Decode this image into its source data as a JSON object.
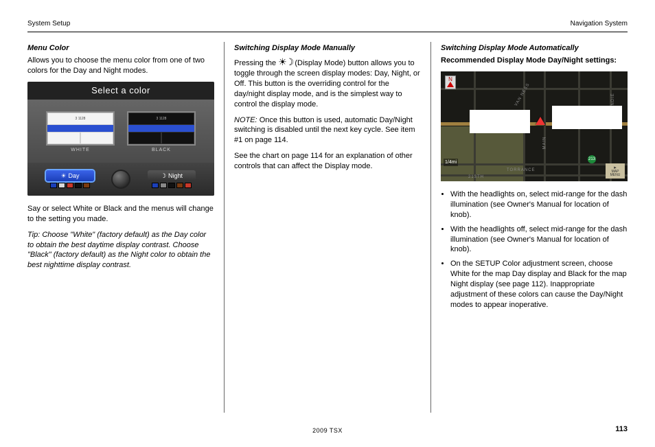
{
  "header": {
    "left": "System Setup",
    "right": "Navigation System"
  },
  "col1": {
    "heading": "Menu Color",
    "body": "Allows you to choose the menu color from one of two colors for the Day and Night modes.",
    "figA": {
      "title": "Select a color",
      "previewWhite": "WHITE",
      "previewBlack": "BLACK",
      "btnDay": "Day",
      "btnNight": "Night",
      "sampleText": "3   1128"
    },
    "p2": "Say or select White or Black and the menus will change to the setting you made.",
    "tipLabel": "Tip:",
    "tip": "Choose \"White\" (factory default) as the Day color to obtain the best daytime display contrast. Choose \"Black\" (factory default) as the Night color to obtain the best nighttime display contrast."
  },
  "col2": {
    "heading": "Switching Display Mode Manually",
    "iconLabel": "☀ ☽",
    "p1": "Pressing the       (Display Mode) button allows you to toggle through the screen display modes: Day, Night, or Off. This button is the overriding control for the day/night display mode, and is the simplest way to control the display mode.",
    "noteLabel": "NOTE:",
    "note": "Once this button is used, automatic Day/Night switching is disabled until the next key cycle. See item #1 on page 114.",
    "p2": "See the chart on page 114 for an explanation of other controls that can affect the Display mode."
  },
  "col3": {
    "heading": "Switching Display Mode Automatically",
    "lead": "Recommended Display Mode Day/Night settings:",
    "figB": {
      "compass": "N",
      "scale": "1/4mi",
      "shield": "213",
      "mapmenu1": "MAP",
      "mapmenu2": "MENU",
      "st1": "TORRANCE",
      "st2": "213TH",
      "st3": "MAIN",
      "st4": "NORMANDIE",
      "st5": "VAN NESS"
    },
    "bullets": [
      "With the headlights on, select mid-range for the dash illumination (see Owner's Manual for location of knob).",
      "With the headlights off, select mid-range for the dash illumination (see Owner's Manual for location of knob).",
      "On the SETUP Color adjustment screen, choose White for the map Day display and Black for the map Night display (see page 112). Inappropriate adjustment of these colors can cause the Day/Night modes to appear inoperative."
    ]
  },
  "footer": {
    "page": "113",
    "book": "2009 TSX"
  }
}
